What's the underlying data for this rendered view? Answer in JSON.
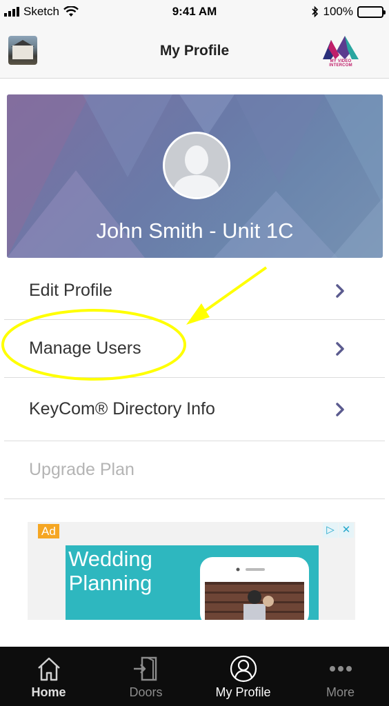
{
  "status_bar": {
    "carrier": "Sketch",
    "time": "9:41 AM",
    "battery": "100%",
    "battery_level": 1.0
  },
  "nav": {
    "title": "My Profile",
    "brand_text": "MY VIDEO INTERCOM",
    "left_icon": "profile-thumbnail",
    "right_icon": "brand-logo"
  },
  "profile": {
    "name": "John Smith - Unit 1C",
    "avatar_icon": "person-silhouette-icon"
  },
  "menu": {
    "items": [
      {
        "label": "Edit Profile",
        "enabled": true
      },
      {
        "label": "Manage Users",
        "enabled": true
      },
      {
        "label": "KeyCom® Directory Info",
        "enabled": true
      },
      {
        "label": "Upgrade Plan",
        "enabled": false
      }
    ]
  },
  "ad": {
    "badge": "Ad",
    "headline": "Wedding Planning",
    "controls": [
      "▷",
      "✕"
    ]
  },
  "tabs": [
    {
      "label": "Home",
      "icon": "home-icon",
      "active": false
    },
    {
      "label": "Doors",
      "icon": "door-enter-icon",
      "active": false
    },
    {
      "label": "My Profile",
      "icon": "user-circle-icon",
      "active": true
    },
    {
      "label": "More",
      "icon": "more-dots-icon",
      "active": false
    }
  ],
  "colors": {
    "accent": "#5b5b8f",
    "tab_bar": "#0d0d0d",
    "annotation": "#ffff00",
    "ad_accent": "#2eb7bf"
  }
}
